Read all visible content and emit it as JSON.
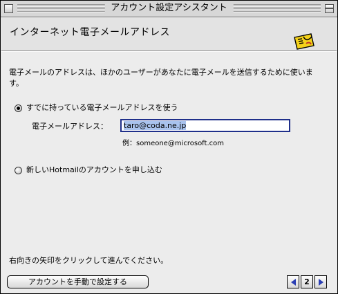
{
  "window": {
    "title": "アカウント設定アシスタント"
  },
  "header": {
    "section_title": "インターネット電子メールアドレス"
  },
  "content": {
    "description": "電子メールのアドレスは、ほかのユーザーがあなたに電子メールを送信するために使います。",
    "option_existing": "すでに持っている電子メールアドレスを使う",
    "email_label": "電子メールアドレス：",
    "email_value": "taro@coda.ne.jp",
    "example": "例：someone@microsoft.com",
    "option_hotmail": "新しいHotmailのアカウントを申し込む",
    "instruction": "右向きの矢印をクリックして進んでください。"
  },
  "footer": {
    "manual_button": "アカウントを手動で設定する",
    "page_number": "2"
  },
  "icons": {
    "close": "close-box-icon",
    "collapse": "collapse-box-icon",
    "logo": "outlook-express-logo-icon",
    "previous": "left-arrow-icon",
    "next": "right-arrow-icon"
  },
  "colors": {
    "input_border": "#1f2f8a",
    "selection": "#a9c3ee",
    "arrow": "#2b3fb3"
  },
  "state": {
    "selected_option": "option_existing"
  }
}
